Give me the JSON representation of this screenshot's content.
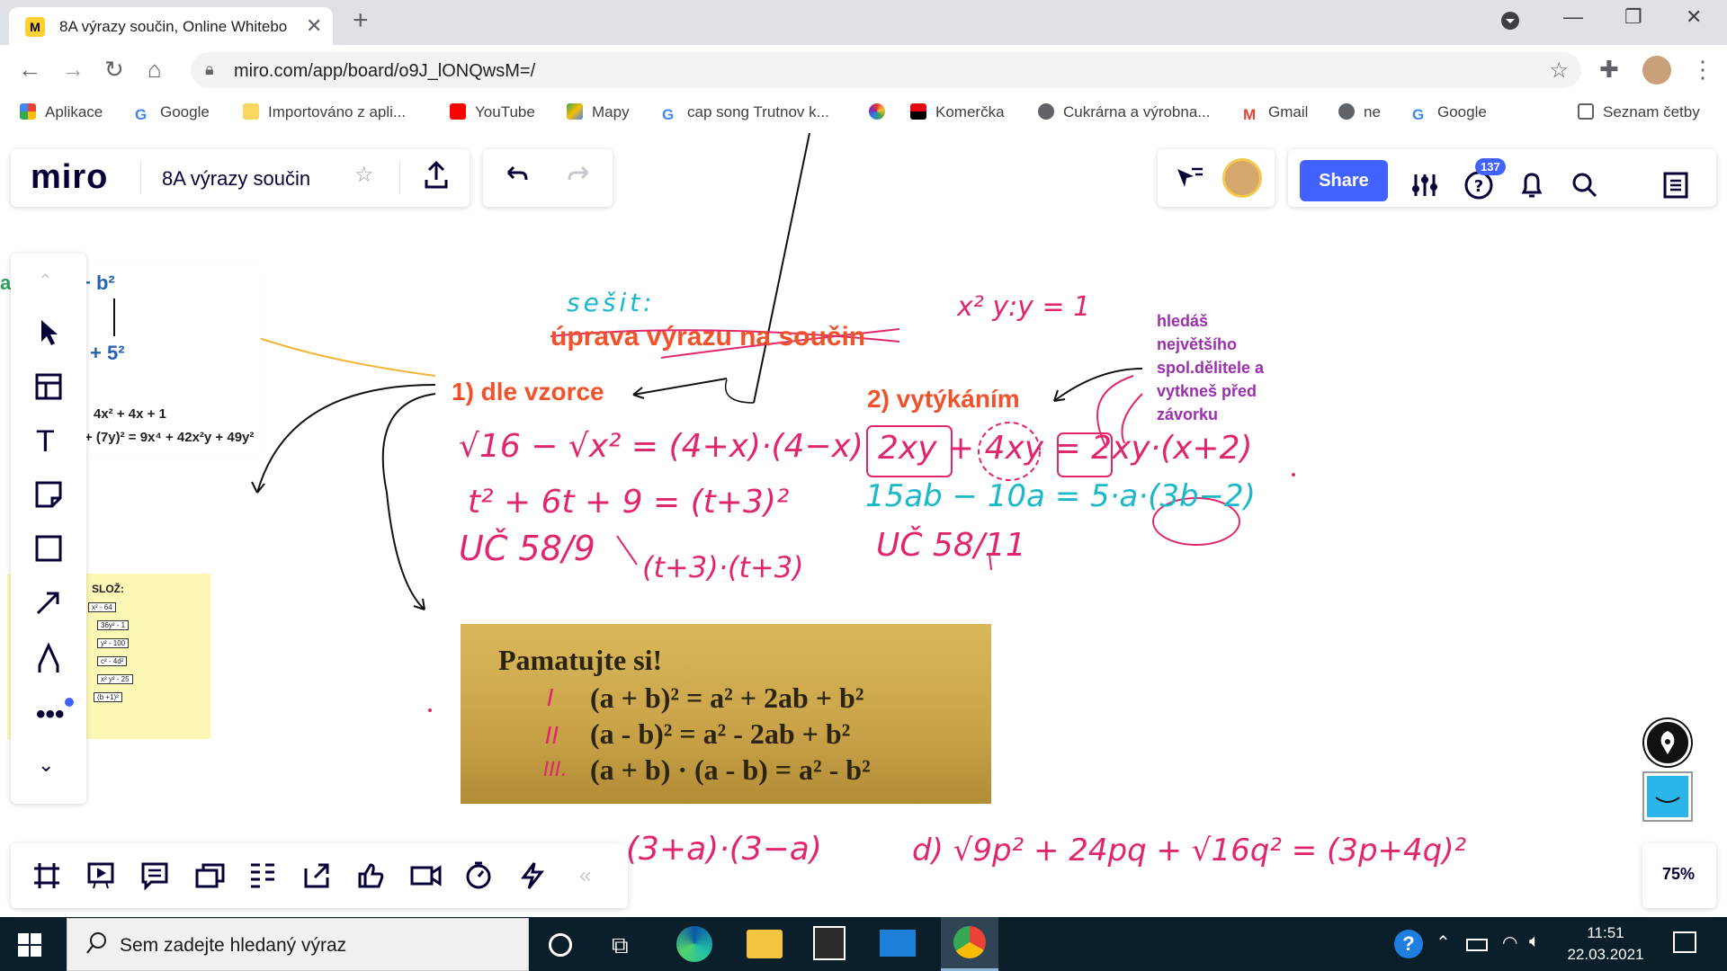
{
  "browser": {
    "tab_title": "8A výrazy součin, Online Whitebo",
    "url": "miro.com/app/board/o9J_lONQwsM=/",
    "bookmarks": [
      "Aplikace",
      "Google",
      "Importováno z apli...",
      "YouTube",
      "Mapy",
      "cap song Trutnov k...",
      "Komerčka",
      "Cukrárna a výrobna...",
      "Gmail",
      "ne",
      "Google"
    ],
    "reading_list": "Seznam četby"
  },
  "miro": {
    "logo": "miro",
    "board_name": "8A výrazy součin",
    "share_label": "Share",
    "notification_count": "137",
    "zoom": "75%"
  },
  "board": {
    "notebook_label": "sešit:",
    "heading": "úprava výrazu na součin",
    "method1": "1) dle vzorce",
    "method2": "2) vytýkáním",
    "hint": "hledáš největšího spol.dělitele a vytkneš před závorku",
    "xy_note": "x² y:y = 1",
    "m1_line1": "√16 − √x² = (4+x)·(4−x)",
    "m1_line2": "t² + 6t + 9 = (t+3)²",
    "m1_line3": "UČ 58/9",
    "m1_line3b": "(t+3)·(t+3)",
    "m2_line1": "2xy + 4xy = 2xy·(x+2)",
    "m2_line2": "15ab − 10a = 5·a·(3b−2)",
    "m2_line3": "UČ 58/11",
    "bottom_left": "(3+a)·(3−a)",
    "bottom_right": "d) √9p² + 24pq + √16q² = (3p+4q)²",
    "card_left_top": "+ b²",
    "card_left_row2": "+ 5²",
    "card_left_row3": "4x² + 4x + 1",
    "card_left_row4": "+ (7y)² = 9x⁴ + 42x²y + 49y²",
    "sticky_title": "SLOŽ:",
    "sticky_items": [
      "x² - 64",
      "36y² - 1",
      "y² - 100",
      "c² - 4d²",
      "x² y² - 25",
      "(b +1)²"
    ],
    "remember": {
      "title": "Pamatujte si!",
      "rows": [
        {
          "num": "I",
          "formula": "(a + b)² = a² + 2ab + b²"
        },
        {
          "num": "II",
          "formula": "(a - b)² = a² - 2ab + b²"
        },
        {
          "num": "III.",
          "formula": "(a + b) · (a - b) = a² - b²"
        }
      ]
    }
  },
  "taskbar": {
    "search_placeholder": "Sem zadejte hledaný výraz",
    "time": "11:51",
    "date": "22.03.2021"
  }
}
